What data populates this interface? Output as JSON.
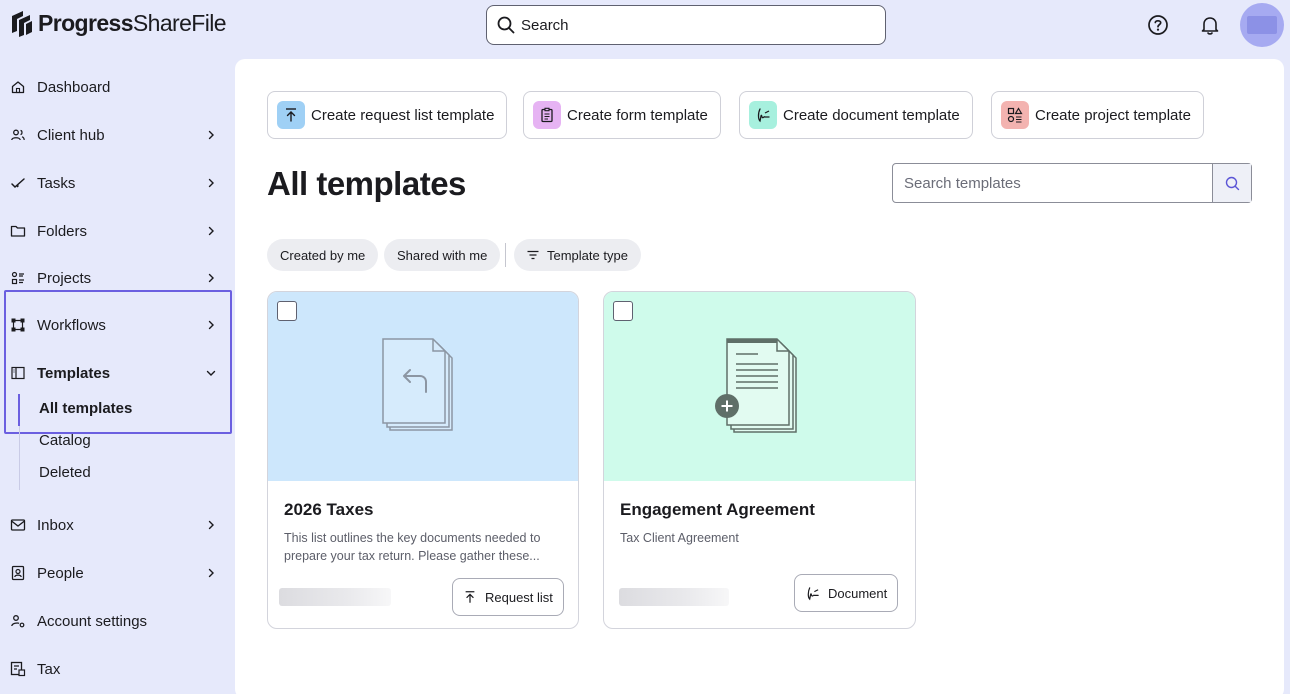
{
  "brand": {
    "name_bold": "Progress",
    "name_rest": "ShareFile"
  },
  "header": {
    "search_label": "Search",
    "help_icon": "help-circle-icon",
    "bell_icon": "bell-icon",
    "avatar_color": "#a6aaf1"
  },
  "sidebar": {
    "items": [
      {
        "label": "Dashboard",
        "icon": "home-icon",
        "chevron": false
      },
      {
        "label": "Client hub",
        "icon": "users-icon",
        "chevron": true
      },
      {
        "label": "Tasks",
        "icon": "check-icon",
        "chevron": true
      },
      {
        "label": "Folders",
        "icon": "folder-icon",
        "chevron": true
      },
      {
        "label": "Projects",
        "icon": "projects-icon",
        "chevron": true
      },
      {
        "label": "Workflows",
        "icon": "workflow-icon",
        "chevron": true
      },
      {
        "label": "Templates",
        "icon": "template-icon",
        "chevron": "down",
        "expanded": true
      },
      {
        "label": "Inbox",
        "icon": "mail-icon",
        "chevron": true
      },
      {
        "label": "People",
        "icon": "contact-icon",
        "chevron": true
      },
      {
        "label": "Account settings",
        "icon": "settings-user-icon",
        "chevron": false
      },
      {
        "label": "Tax",
        "icon": "tax-icon",
        "chevron": false
      }
    ],
    "template_sub": [
      "All templates",
      "Catalog",
      "Deleted"
    ],
    "active_sub": "All templates",
    "accent": "#6b5fe0"
  },
  "create_buttons": [
    {
      "label": "Create request list template",
      "icon": "upload-icon",
      "color": "#9fd0f5"
    },
    {
      "label": "Create form template",
      "icon": "clipboard-icon",
      "color": "#e6b3f3"
    },
    {
      "label": "Create document template",
      "icon": "signature-icon",
      "color": "#a7f0de"
    },
    {
      "label": "Create project template",
      "icon": "shapes-icon",
      "color": "#f3b3b0"
    }
  ],
  "page_title": "All templates",
  "template_search": {
    "placeholder": "Search templates"
  },
  "filters": [
    "Created by me",
    "Shared with me",
    "Template type"
  ],
  "cards": [
    {
      "title": "2026 Taxes",
      "description": "This list outlines the key documents needed to prepare your tax return. Please gather these...",
      "type": "Request list",
      "bg": "#cde7fc"
    },
    {
      "title": "Engagement Agreement",
      "description": "Tax Client Agreement",
      "type": "Document",
      "bg": "#cffbeb"
    }
  ]
}
